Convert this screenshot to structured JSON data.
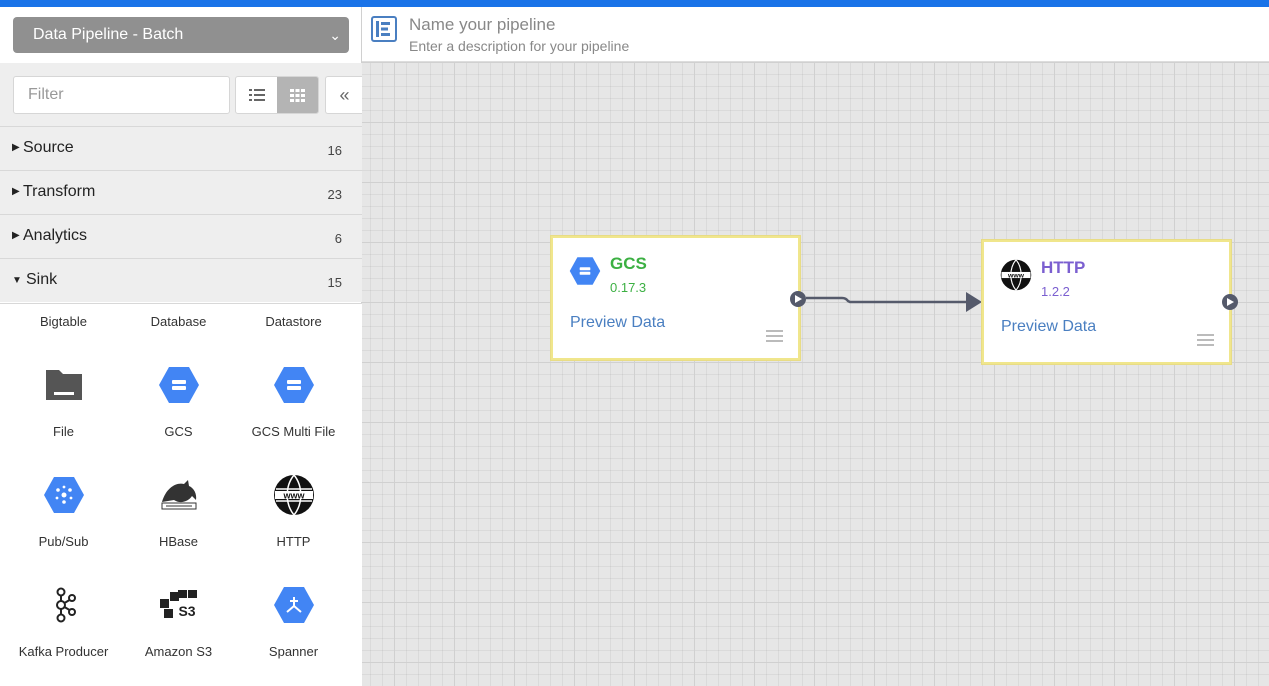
{
  "pipeline_type": "Data Pipeline - Batch",
  "filter": {
    "placeholder": "Filter"
  },
  "groups": [
    {
      "label": "Source",
      "count": "16",
      "expanded": false
    },
    {
      "label": "Transform",
      "count": "23",
      "expanded": false
    },
    {
      "label": "Analytics",
      "count": "6",
      "expanded": false
    },
    {
      "label": "Sink",
      "count": "15",
      "expanded": true
    }
  ],
  "sink_plugins": [
    {
      "label": "Bigtable",
      "icon": "bigtable-icon"
    },
    {
      "label": "Database",
      "icon": "database-icon"
    },
    {
      "label": "Datastore",
      "icon": "datastore-icon"
    },
    {
      "label": "File",
      "icon": "folder-icon"
    },
    {
      "label": "GCS",
      "icon": "gcs-icon"
    },
    {
      "label": "GCS Multi File",
      "icon": "gcs-icon"
    },
    {
      "label": "Pub/Sub",
      "icon": "pubsub-icon"
    },
    {
      "label": "HBase",
      "icon": "hbase-icon"
    },
    {
      "label": "HTTP",
      "icon": "www-icon"
    },
    {
      "label": "Kafka Producer",
      "icon": "kafka-icon"
    },
    {
      "label": "Amazon S3",
      "icon": "s3-icon"
    },
    {
      "label": "Spanner",
      "icon": "spanner-icon"
    }
  ],
  "header": {
    "name_placeholder": "Name your pipeline",
    "description_placeholder": "Enter a description for your pipeline"
  },
  "nodes": [
    {
      "title": "GCS",
      "version": "0.17.3",
      "preview": "Preview Data",
      "color": "#3cb043",
      "icon": "gcs-icon"
    },
    {
      "title": "HTTP",
      "version": "1.2.2",
      "preview": "Preview Data",
      "color": "#7b5fd0",
      "icon": "www-icon"
    }
  ],
  "colors": {
    "accent": "#1a73e8",
    "node_border": "#f0e68c",
    "link": "#4a7fc1"
  }
}
